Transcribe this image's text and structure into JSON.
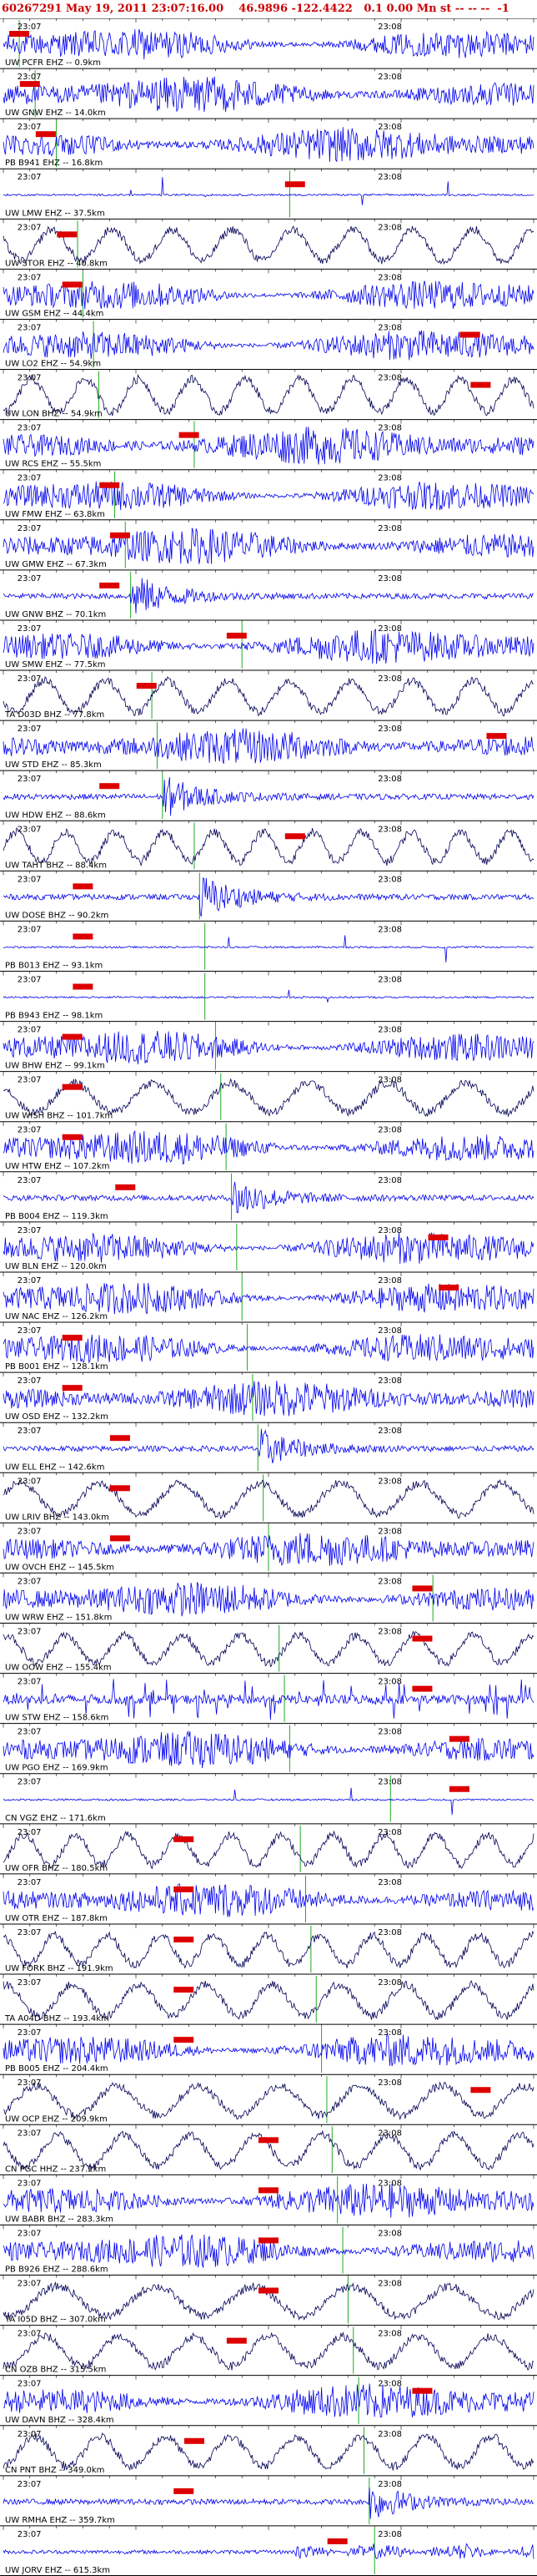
{
  "header": {
    "title": "60267291 May 19, 2011 23:07:16.00    46.9896 -122.4422   0.1 0.00 Mn st -- -- --  -1"
  },
  "colors": {
    "trace": "#0000ee",
    "trace_dark": "#000055",
    "tick": "#000000",
    "pick_line": "#22aa22",
    "marker": "#dd0000",
    "header": "#cc0000"
  },
  "chart_data": {
    "type": "line",
    "x_tick_labels": [
      "23:07",
      "23:08"
    ],
    "traces": [
      {
        "label": "UW PCFR EHZ -- 0.9km",
        "style": "noise",
        "amp": 0.8,
        "marker": 0.03,
        "pick": 0.03
      },
      {
        "label": "UW GNW EHZ -- 14.0km",
        "style": "noise",
        "amp": 0.85,
        "marker": 0.05,
        "pick": 0.06
      },
      {
        "label": "PB B941 EHZ -- 16.8km",
        "style": "noise",
        "amp": 0.8,
        "marker": 0.08,
        "pick": 0.1
      },
      {
        "label": "UW LMW EHZ -- 37.5km",
        "style": "flat",
        "amp": 0.2,
        "marker": 0.55,
        "pick": 0.54
      },
      {
        "label": "UW STOR EHZ -- 40.8km",
        "style": "slow",
        "amp": 0.9,
        "marker": 0.12,
        "pick": 0.14
      },
      {
        "label": "UW GSM EHZ -- 44.4km",
        "style": "noise",
        "amp": 0.8,
        "marker": 0.13,
        "pick": 0.15
      },
      {
        "label": "UW LO2 EHZ -- 54.9km",
        "style": "noise",
        "amp": 0.8,
        "marker": 0.88,
        "pick": 0.17
      },
      {
        "label": "UW LON BHZ -- 54.9km",
        "style": "slow",
        "amp": 0.95,
        "marker": 0.9,
        "pick": 0.18
      },
      {
        "label": "UW RCS EHZ -- 55.5km",
        "style": "noise",
        "amp": 0.85,
        "marker": 0.35,
        "pick": 0.36
      },
      {
        "label": "UW FMW EHZ -- 63.8km",
        "style": "noise",
        "amp": 0.8,
        "marker": 0.2,
        "pick": 0.21
      },
      {
        "label": "UW GMW EHZ -- 67.3km",
        "style": "noise",
        "amp": 0.85,
        "marker": 0.22,
        "pick": 0.23
      },
      {
        "label": "UW GNW BHZ -- 70.1km",
        "style": "burst",
        "amp": 0.95,
        "marker": 0.2,
        "pick": 0.24
      },
      {
        "label": "UW SMW EHZ -- 77.5km",
        "style": "noise",
        "amp": 0.85,
        "marker": 0.44,
        "pick": 0.45
      },
      {
        "label": "TA D03D BHZ -- 77.8km",
        "style": "slow",
        "amp": 0.9,
        "marker": 0.27,
        "pick": 0.28
      },
      {
        "label": "UW STD EHZ -- 85.3km",
        "style": "noise",
        "amp": 0.8,
        "marker": 0.93,
        "pick": 0.29
      },
      {
        "label": "UW HDW EHZ -- 88.6km",
        "style": "burst",
        "amp": 0.9,
        "marker": 0.2,
        "pick": 0.3
      },
      {
        "label": "UW TAHT BHZ -- 88.4km",
        "style": "slow",
        "amp": 0.85,
        "marker": 0.55,
        "pick": 0.36
      },
      {
        "label": "UW DOSE BHZ -- 90.2km",
        "style": "burst",
        "amp": 0.95,
        "marker": 0.15,
        "pick": 0.37
      },
      {
        "label": "PB B013 EHZ -- 93.1km",
        "style": "flat",
        "amp": 0.25,
        "marker": 0.15,
        "pick": 0.38
      },
      {
        "label": "PB B943 EHZ -- 98.1km",
        "style": "flat",
        "amp": 0.25,
        "marker": 0.15,
        "pick": 0.38
      },
      {
        "label": "UW BHW EHZ -- 99.1km",
        "style": "noise",
        "amp": 0.85,
        "marker": 0.13,
        "pick": 0.4
      },
      {
        "label": "UW WISH BHZ -- 101.7km",
        "style": "slow",
        "amp": 0.85,
        "marker": 0.13,
        "pick": 0.41
      },
      {
        "label": "UW HTW EHZ -- 107.2km",
        "style": "noise",
        "amp": 0.85,
        "marker": 0.13,
        "pick": 0.42
      },
      {
        "label": "PB B004 EHZ -- 119.3km",
        "style": "burst",
        "amp": 0.9,
        "marker": 0.23,
        "pick": 0.43
      },
      {
        "label": "UW BLN EHZ -- 120.0km",
        "style": "noise",
        "amp": 0.85,
        "marker": 0.82,
        "pick": 0.44
      },
      {
        "label": "UW NAC EHZ -- 126.2km",
        "style": "noise",
        "amp": 0.85,
        "marker": 0.84,
        "pick": 0.45
      },
      {
        "label": "PB B001 EHZ -- 128.1km",
        "style": "noise",
        "amp": 0.8,
        "marker": 0.13,
        "pick": 0.46
      },
      {
        "label": "UW OSD EHZ -- 132.2km",
        "style": "noise",
        "amp": 0.8,
        "marker": 0.13,
        "pick": 0.47
      },
      {
        "label": "UW ELL EHZ -- 142.6km",
        "style": "burst",
        "amp": 0.85,
        "marker": 0.22,
        "pick": 0.48
      },
      {
        "label": "UW LRIV BHZ -- 143.0km",
        "style": "slow",
        "amp": 0.9,
        "marker": 0.22,
        "pick": 0.49
      },
      {
        "label": "UW OVCH EHZ -- 145.5km",
        "style": "noise",
        "amp": 0.8,
        "marker": 0.22,
        "pick": 0.5
      },
      {
        "label": "UW WRW EHZ -- 151.8km",
        "style": "noise",
        "amp": 0.8,
        "marker": 0.79,
        "pick": 0.81
      },
      {
        "label": "UW OOW EHZ -- 155.4km",
        "style": "slow",
        "amp": 0.8,
        "marker": 0.79,
        "pick": 0.52
      },
      {
        "label": "UW STW EHZ -- 158.6km",
        "style": "spiky",
        "amp": 0.9,
        "marker": 0.79,
        "pick": 0.53
      },
      {
        "label": "UW PGO EHZ -- 169.9km",
        "style": "noise",
        "amp": 0.85,
        "marker": 0.86,
        "pick": 0.54
      },
      {
        "label": "CN VGZ EHZ -- 171.6km",
        "style": "flat",
        "amp": 0.15,
        "marker": 0.86,
        "pick": 0.73
      },
      {
        "label": "UW OFR BHZ -- 180.5km",
        "style": "slow",
        "amp": 0.85,
        "marker": 0.34,
        "pick": 0.56
      },
      {
        "label": "UW OTR EHZ -- 187.8km",
        "style": "noise",
        "amp": 0.8,
        "marker": 0.34,
        "pick": 0.57
      },
      {
        "label": "UW FORK BHZ -- 191.9km",
        "style": "slow",
        "amp": 0.85,
        "marker": 0.34,
        "pick": 0.58
      },
      {
        "label": "TA A04D BHZ -- 193.4km",
        "style": "slow",
        "amp": 0.9,
        "marker": 0.34,
        "pick": 0.59
      },
      {
        "label": "PB B005 EHZ -- 204.4km",
        "style": "noise",
        "amp": 0.85,
        "marker": 0.34,
        "pick": 0.6
      },
      {
        "label": "UW OCP EHZ -- 209.9km",
        "style": "slow",
        "amp": 0.85,
        "marker": 0.9,
        "pick": 0.61
      },
      {
        "label": "CN PGC HHZ -- 237.2km",
        "style": "slow",
        "amp": 0.9,
        "marker": 0.5,
        "pick": 0.62
      },
      {
        "label": "UW BABR BHZ -- 283.3km",
        "style": "noise",
        "amp": 0.85,
        "marker": 0.5,
        "pick": 0.63
      },
      {
        "label": "PB B926 EHZ -- 288.6km",
        "style": "noise",
        "amp": 0.8,
        "marker": 0.5,
        "pick": 0.64
      },
      {
        "label": "TA I05D BHZ -- 307.0km",
        "style": "slow",
        "amp": 0.85,
        "marker": 0.5,
        "pick": 0.65
      },
      {
        "label": "CN OZB BHZ -- 315.5km",
        "style": "slow",
        "amp": 0.85,
        "marker": 0.44,
        "pick": 0.66
      },
      {
        "label": "UW DAVN BHZ -- 328.4km",
        "style": "noise",
        "amp": 0.85,
        "marker": 0.79,
        "pick": 0.67
      },
      {
        "label": "CN PNT BHZ -- 349.0km",
        "style": "slow",
        "amp": 0.85,
        "marker": 0.36,
        "pick": 0.68
      },
      {
        "label": "UW RMHA EHZ -- 359.7km",
        "style": "burst",
        "amp": 0.8,
        "marker": 0.34,
        "pick": 0.69
      },
      {
        "label": "UW JORV EHZ -- 615.3km",
        "style": "quiet",
        "amp": 0.5,
        "marker": 0.63,
        "pick": 0.7
      }
    ]
  }
}
